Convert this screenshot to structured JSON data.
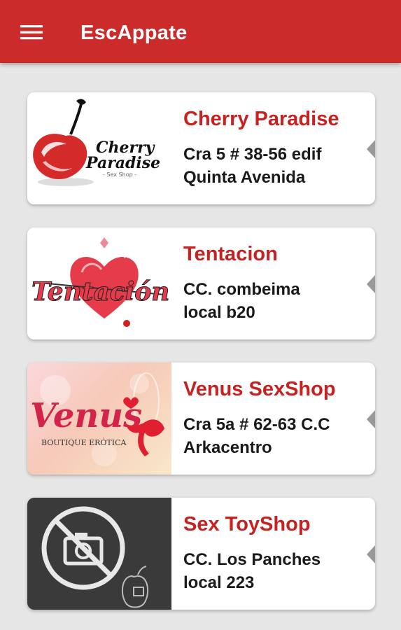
{
  "app_bar": {
    "title": "EscAppate",
    "menu_icon": "menu-icon",
    "color": "#cc2b2b"
  },
  "shops": [
    {
      "name": "Cherry Paradise",
      "address": "Cra 5 # 38-56 edif\nQuinta Avenida",
      "logo_text": [
        "Cherry",
        "Paradise",
        "- Sex Shop -"
      ]
    },
    {
      "name": "Tentacion",
      "address": "CC. combeima\nlocal b20",
      "logo_text": [
        "Tentación"
      ]
    },
    {
      "name": "Venus SexShop",
      "address": "Cra 5a # 62-63 C.C\nArkacentro",
      "logo_text": [
        "Venus",
        "BOUTIQUE ERÓTICA"
      ]
    },
    {
      "name": "Sex ToyShop",
      "address": "CC. Los Panches\nlocal 223",
      "logo_text": []
    }
  ],
  "colors": {
    "accent": "#cc2b2b",
    "name_text": "#c62222",
    "background": "#e6e6e6"
  }
}
